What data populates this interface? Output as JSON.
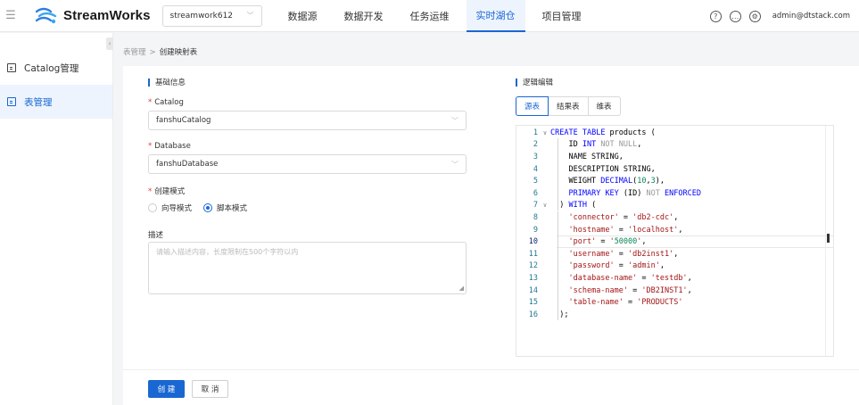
{
  "app": {
    "name": "StreamWorks"
  },
  "workspace": {
    "value": "streamwork612"
  },
  "nav": [
    {
      "label": "数据源"
    },
    {
      "label": "数据开发"
    },
    {
      "label": "任务运维"
    },
    {
      "label": "实时湖仓",
      "active": true
    },
    {
      "label": "项目管理"
    }
  ],
  "user": {
    "name": "admin@dtstack.com"
  },
  "sidebar": [
    {
      "label": "Catalog管理",
      "icon": "catalog-icon"
    },
    {
      "label": "表管理",
      "icon": "table-icon",
      "active": true
    }
  ],
  "breadcrumb": {
    "parent": "表管理",
    "separator": ">",
    "current": "创建映射表"
  },
  "form": {
    "section_title": "基础信息",
    "catalog": {
      "label": "Catalog",
      "value": "fanshuCatalog"
    },
    "database": {
      "label": "Database",
      "value": "fanshuDatabase"
    },
    "mode": {
      "label": "创建模式",
      "options": [
        "向导模式",
        "脚本模式"
      ],
      "selected": "脚本模式"
    },
    "description": {
      "label": "描述",
      "placeholder": "请输入描述内容，长度限制在500个字符以内"
    }
  },
  "editor": {
    "section_title": "逻辑编辑",
    "tabs": [
      {
        "label": "源表",
        "active": true
      },
      {
        "label": "结果表"
      },
      {
        "label": "维表"
      }
    ],
    "current_line": 10,
    "lines": [
      "CREATE TABLE products (",
      "    ID INT NOT NULL,",
      "    NAME STRING,",
      "    DESCRIPTION STRING,",
      "    WEIGHT DECIMAL(10,3),",
      "    PRIMARY KEY (ID) NOT ENFORCED",
      "  ) WITH (",
      "    'connector' = 'db2-cdc',",
      "    'hostname' = 'localhost',",
      "    'port' = '50000',",
      "    'username' = 'db2inst1',",
      "    'password' = 'admin',",
      "    'database-name' = 'testdb',",
      "    'schema-name' = 'DB2INST1',",
      "    'table-name' = 'PRODUCTS'",
      "  );"
    ]
  },
  "actions": {
    "create": "创 建",
    "cancel": "取 消"
  },
  "colors": {
    "accent": "#1967d2",
    "required": "#e53935"
  }
}
